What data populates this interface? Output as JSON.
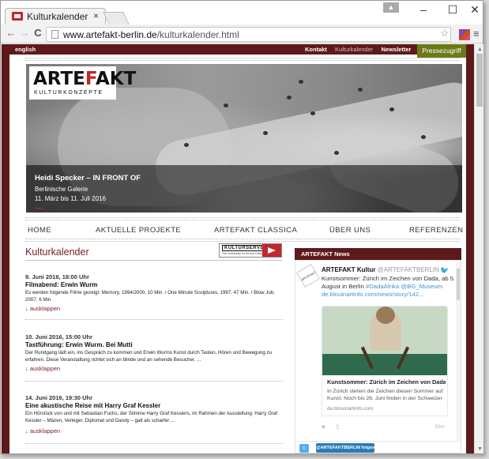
{
  "browser": {
    "tab_title": "Kulturkalender",
    "tab_close": "×",
    "url_prefix": "www.artefakt-berlin.de",
    "url_path": "/kulturkalender.html",
    "window_controls": {
      "minimize": "–",
      "maximize": "☐",
      "close": "✕"
    },
    "nav": {
      "back": "←",
      "forward": "→",
      "reload": "C"
    },
    "star": "☆",
    "menu": "≡"
  },
  "topbar": {
    "lang": "english",
    "links": [
      "Kontakt",
      "Kulturkalender",
      "Newsletter"
    ],
    "press_button": "Pressezugriff"
  },
  "logo": {
    "wordmark_left": "ARTE",
    "wordmark_mark": "F",
    "wordmark_right": "AKT",
    "subtitle": "KULTURKONZEPTE"
  },
  "hero": {
    "title": "Heidi Specker – IN FRONT OF",
    "venue": "Berlinische Galerie",
    "dates": "11. März bis 11. Juli 2016"
  },
  "mainnav": [
    "HOME",
    "AKTUELLE PROJEKTE",
    "ARTEFAKT CLASSICA",
    "ÜBER UNS",
    "REFERENZEN"
  ],
  "kalender": {
    "title": "Kulturkalender",
    "badge_word": "KULTURSERVER",
    "badge_tagline": "The community for Art and Culture",
    "events": [
      {
        "date": "9. Juni 2016, 18:00 Uhr",
        "title": "Filmabend: Erwin Wurm",
        "desc": "Es werden folgende Filme gezeigt: Memory, 1994/2000, 10 Min. / One Minute Sculptures, 1997, 47 Min. / Blow Job, 2007, 6 Min",
        "more": "↓ ausklappen"
      },
      {
        "date": "10. Juni 2016, 15:00 Uhr",
        "title": "Tastführung: Erwin Wurm. Bei Mutti",
        "desc": "Der Rundgang lädt ein, ins Gespräch zu kommen und Erwin Wurms Kunst durch Tasten, Hören und Bewegung zu erfahren. Diese Veranstaltung richtet sich an blinde und an sehende Besucher. ...",
        "more": "↓ ausklappen"
      },
      {
        "date": "14. Juni 2016, 19:30 Uhr",
        "title": "Eine akustische Reise mit Harry Graf Kessler",
        "desc": "Ein Hörstück von und mit Sebastian Fuchs, der Stimme Harry Graf Kesslers, im Rahmen der Ausstellung: Harry Graf Kessler – Mäzen, Verleger, Diplomat und Dandy – galt als scharfer ...",
        "more": "↓ ausklappen"
      }
    ]
  },
  "news": {
    "header": "ARTEFAKT News",
    "tweet": {
      "avatar_text": "ARTEFAKT",
      "name": "ARTEFAKT Kultur",
      "handle": "@ARTEFAKTBERLIN",
      "text_plain": "Kunstsommer: Zürich im Zeichen von Dada, ab 5. August in Berlin ",
      "hashtag": "#DadaAfrika",
      "mention": "@BG_Museum",
      "link": "de.blouinartinfo.com/news/story/142...",
      "card_title": "Kunstsommer: Zürich im Zeichen von Dada un...",
      "card_desc": "In Zürich stehen die Zeichen diesen Sommer auf Kunst. Noch bis 26. Juni finden in der Schweizer",
      "card_domain": "de.blouinartinfo.com",
      "time": "30m"
    },
    "follow_button": "@ARTEFAKTBERLIN folgen"
  }
}
